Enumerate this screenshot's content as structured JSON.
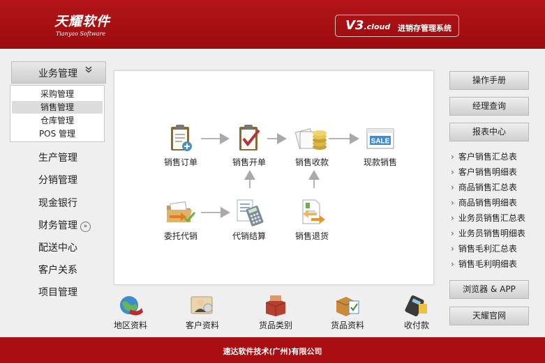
{
  "header": {
    "logo_cn": "天耀软件",
    "logo_en": "Tianyao Software",
    "version_main": "V3",
    "version_sub": ".cloud",
    "system_name": "进销存管理系统"
  },
  "left_menu": {
    "head_label": "业务管理",
    "submenu": [
      "采购管理",
      "销售管理",
      "仓库管理",
      "POS 管理"
    ],
    "selected_submenu": "销售管理",
    "nav": [
      "生产管理",
      "分销管理",
      "现金银行",
      "财务管理",
      "配送中心",
      "客户关系",
      "项目管理"
    ]
  },
  "flow": {
    "sales_order": "销售订单",
    "sales_invoice": "销售开单",
    "sales_receipt": "销售收款",
    "cash_sale": "现款销售",
    "consign_sale": "委托代销",
    "consign_settle": "代销结算",
    "sales_return": "销售退货",
    "sale_badge": "SALE"
  },
  "shortcuts": [
    "地区资料",
    "客户资料",
    "货品类别",
    "货品资料",
    "收付款"
  ],
  "right_panel": {
    "manual": "操作手册",
    "manager_query": "经理查询",
    "report_center": "报表中心",
    "reports": [
      "客户销售汇总表",
      "客户销售明细表",
      "商品销售汇总表",
      "商品销售明细表",
      "业务员销售汇总表",
      "业务员销售明细表",
      "销售毛利汇总表",
      "销售毛利明细表"
    ],
    "browser_app": "浏览器 & APP",
    "official_site": "天耀官网"
  },
  "footer": {
    "company": "速达软件技术(广州)有限公司"
  },
  "colors": {
    "brand_red": "#a90f12",
    "panel_bg": "#efefef"
  }
}
